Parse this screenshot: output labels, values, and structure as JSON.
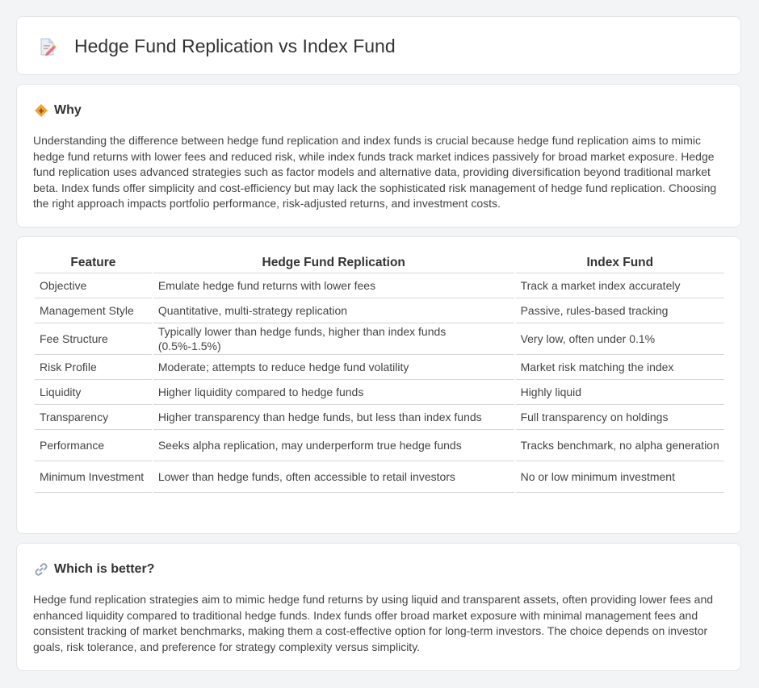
{
  "header": {
    "title": "Hedge Fund Replication vs Index Fund",
    "icon": "document-pencil-icon"
  },
  "why": {
    "heading": "Why",
    "icon": "diamond-sign-icon",
    "text": "Understanding the difference between hedge fund replication and index funds is crucial because hedge fund replication aims to mimic hedge fund returns with lower fees and reduced risk, while index funds track market indices passively for broad market exposure. Hedge fund replication uses advanced strategies such as factor models and alternative data, providing diversification beyond traditional market beta. Index funds offer simplicity and cost-efficiency but may lack the sophisticated risk management of hedge fund replication. Choosing the right approach impacts portfolio performance, risk-adjusted returns, and investment costs."
  },
  "comparison": {
    "headers": [
      "Feature",
      "Hedge Fund Replication",
      "Index Fund"
    ],
    "rows": [
      [
        "Objective",
        "Emulate hedge fund returns with lower fees",
        "Track a market index accurately"
      ],
      [
        "Management Style",
        "Quantitative, multi-strategy replication",
        "Passive, rules-based tracking"
      ],
      [
        "Fee Structure",
        "Typically lower than hedge funds, higher than index funds (0.5%-1.5%)",
        "Very low, often under 0.1%"
      ],
      [
        "Risk Profile",
        "Moderate; attempts to reduce hedge fund volatility",
        "Market risk matching the index"
      ],
      [
        "Liquidity",
        "Higher liquidity compared to hedge funds",
        "Highly liquid"
      ],
      [
        "Transparency",
        "Higher transparency than hedge funds, but less than index funds",
        "Full transparency on holdings"
      ],
      [
        "Performance",
        "Seeks alpha replication, may underperform true hedge funds",
        "Tracks benchmark, no alpha generation"
      ],
      [
        "Minimum Investment",
        "Lower than hedge funds, often accessible to retail investors",
        "No or low minimum investment"
      ]
    ]
  },
  "better": {
    "heading": "Which is better?",
    "icon": "link-icon",
    "text": "Hedge fund replication strategies aim to mimic hedge fund returns by using liquid and transparent assets, often providing lower fees and enhanced liquidity compared to traditional hedge funds. Index funds offer broad market exposure with minimal management fees and consistent tracking of market benchmarks, making them a cost-effective option for long-term investors. The choice depends on investor goals, risk tolerance, and preference for strategy complexity versus simplicity."
  },
  "colors": {
    "accent_orange": "#f2a23a",
    "icon_pink": "#e8737a",
    "text": "#444444",
    "background": "#f3f4f6"
  }
}
